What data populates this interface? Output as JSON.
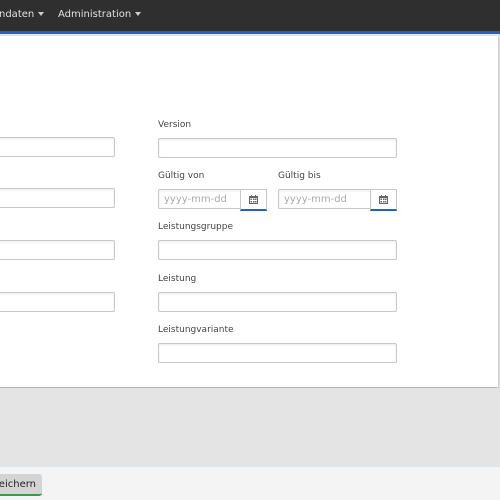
{
  "navbar": {
    "items": [
      {
        "label": "ndaten",
        "icon": "caret-down-icon"
      },
      {
        "label": "Administration",
        "icon": "caret-down-icon"
      }
    ],
    "accent": "#1e63c4"
  },
  "form": {
    "version": {
      "label": "Version",
      "value": ""
    },
    "gueltig_von": {
      "label": "Gültig von",
      "placeholder": "yyyy-mm-dd",
      "icon": "calendar-icon"
    },
    "gueltig_bis": {
      "label": "Gültig bis",
      "placeholder": "yyyy-mm-dd",
      "icon": "calendar-icon"
    },
    "leistungsgruppe": {
      "label": "Leistungsgruppe",
      "value": ""
    },
    "leistung": {
      "label": "Leistung",
      "value": ""
    },
    "leistungvariante": {
      "label": "Leistungvariante",
      "value": ""
    }
  },
  "footer": {
    "save_label": "peichern"
  }
}
